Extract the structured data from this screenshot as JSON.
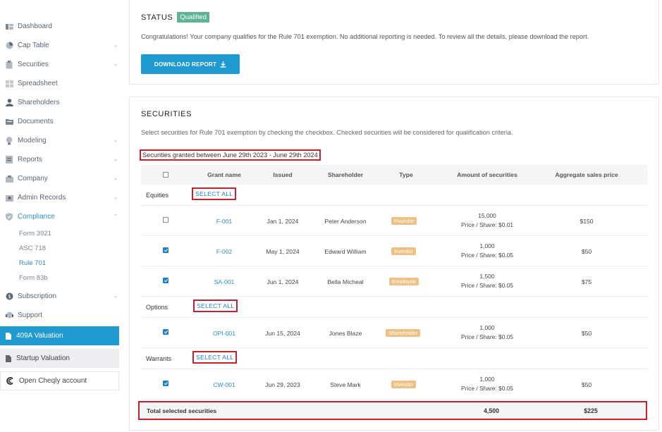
{
  "sidebar": {
    "items": [
      {
        "label": "Dashboard",
        "icon": "dashboard-icon",
        "chevron": false
      },
      {
        "label": "Cap Table",
        "icon": "pie-chart-icon",
        "chevron": true
      },
      {
        "label": "Securities",
        "icon": "clipboard-icon",
        "chevron": true
      },
      {
        "label": "Spreadsheet",
        "icon": "spreadsheet-icon",
        "chevron": false
      },
      {
        "label": "Shareholders",
        "icon": "user-icon",
        "chevron": false
      },
      {
        "label": "Documents",
        "icon": "folder-icon",
        "chevron": false
      },
      {
        "label": "Modeling",
        "icon": "lightbulb-icon",
        "chevron": true
      },
      {
        "label": "Reports",
        "icon": "report-icon",
        "chevron": true
      },
      {
        "label": "Company",
        "icon": "building-icon",
        "chevron": true
      },
      {
        "label": "Admin Records",
        "icon": "admin-icon",
        "chevron": true
      },
      {
        "label": "Compliance",
        "icon": "shield-icon",
        "chevron": true,
        "expanded": true
      }
    ],
    "compliance_sub": [
      "Form 3921",
      "ASC 718",
      "Rule 701",
      "Form 83b"
    ],
    "after_items": [
      {
        "label": "Subscription",
        "icon": "subscription-icon",
        "chevron": true
      },
      {
        "label": "Support",
        "icon": "support-icon",
        "chevron": false
      }
    ],
    "btn_409a": "409A Valuation",
    "btn_startup": "Startup Valuation",
    "btn_cheqly": "Open Cheqly account"
  },
  "status": {
    "title": "STATUS",
    "badge": "Qualified",
    "message": "Congratulations! Your company qualifies for the Rule 701 exemption. No additional reporting is needed. To review all the details, please download the report.",
    "download_label": "DOWNLOAD REPORT"
  },
  "securities": {
    "title": "SECURITIES",
    "description": "Select securities for Rule 701 exemption by checking the checkbox. Checked securities will be considered for qualification criteria.",
    "range": "Securities granted between June 29th 2023 - June 29th 2024",
    "select_all": "SELECT ALL",
    "columns": [
      "Grant name",
      "Issued",
      "Shareholder",
      "Type",
      "Amount of securities",
      "Aggregate sales price"
    ],
    "groups": [
      {
        "label": "Equities",
        "rows": [
          {
            "checked": false,
            "grant": "F-001",
            "issued": "Jan 1, 2024",
            "shareholder": "Peter Anderson",
            "type": "Founder",
            "amount": "15,000",
            "price_share": "Price / Share: $0.01",
            "aggregate": "$150"
          },
          {
            "checked": true,
            "grant": "F-002",
            "issued": "May 1, 2024",
            "shareholder": "Edward William",
            "type": "Investor",
            "amount": "1,000",
            "price_share": "Price / Share: $0.05",
            "aggregate": "$50"
          },
          {
            "checked": true,
            "grant": "SA-001",
            "issued": "Jun 1, 2024",
            "shareholder": "Bella Micheal",
            "type": "Employee",
            "amount": "1,500",
            "price_share": "Price / Share: $0.05",
            "aggregate": "$75"
          }
        ]
      },
      {
        "label": "Options",
        "rows": [
          {
            "checked": true,
            "grant": "OPI-001",
            "issued": "Jun 15, 2024",
            "shareholder": "Jones Blaze",
            "type": "Shareholder",
            "amount": "1,000",
            "price_share": "Price / Share: $0.05",
            "aggregate": "$50"
          }
        ]
      },
      {
        "label": "Warrants",
        "rows": [
          {
            "checked": true,
            "grant": "CW-001",
            "issued": "Jun 29, 2023",
            "shareholder": "Steve Mark",
            "type": "Investor",
            "amount": "1,000",
            "price_share": "Price / Share: $0.05",
            "aggregate": "$50"
          }
        ]
      }
    ],
    "total": {
      "label": "Total selected securities",
      "amount": "4,500",
      "aggregate": "$225"
    }
  },
  "colors": {
    "accent": "#1e9ad0",
    "highlight": "#c8202f",
    "badge_qualified": "#5cb395",
    "type_badge": "#efc084"
  }
}
